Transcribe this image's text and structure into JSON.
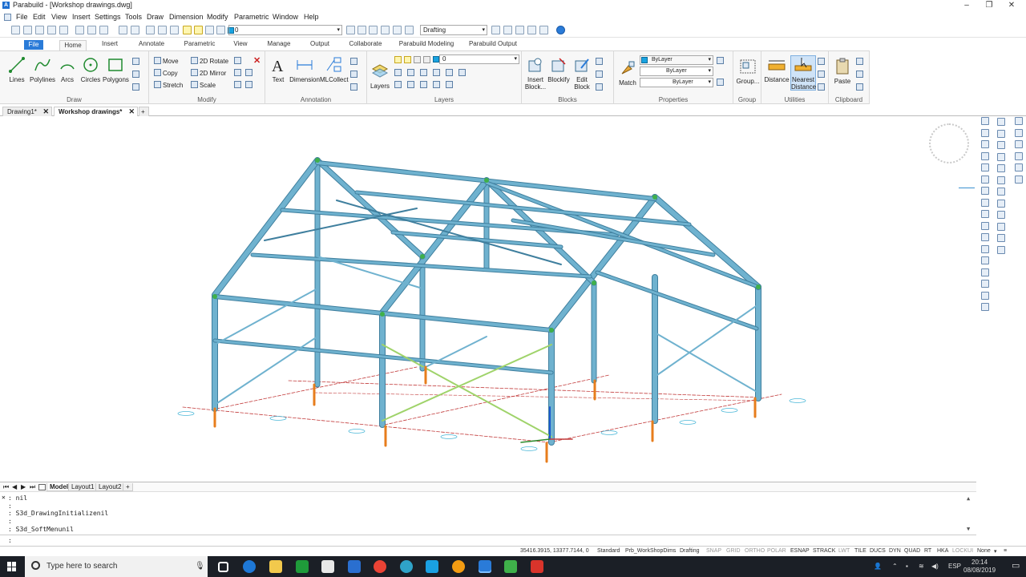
{
  "window": {
    "title": "Parabuild - [Workshop drawings.dwg]",
    "controls": [
      "–",
      "❐",
      "✕"
    ]
  },
  "menu": [
    "File",
    "Edit",
    "View",
    "Insert",
    "Settings",
    "Tools",
    "Draw",
    "Dimension",
    "Modify",
    "Parametric",
    "Window",
    "Help"
  ],
  "quickbar": {
    "layer_value": "0",
    "workspace_value": "Drafting"
  },
  "ribbon_tabs": [
    "File",
    "Home",
    "Insert",
    "Annotate",
    "Parametric",
    "View",
    "Manage",
    "Output",
    "Collaborate",
    "Parabuild Modeling",
    "Parabuild Output"
  ],
  "ribbon": {
    "draw": {
      "title": "Draw",
      "buttons": [
        "Lines",
        "Polylines",
        "Arcs",
        "Circles",
        "Polygons"
      ]
    },
    "modify": {
      "title": "Modify",
      "items": [
        "Move",
        "Copy",
        "Stretch",
        "2D Rotate",
        "2D Mirror",
        "Scale"
      ]
    },
    "annotation": {
      "title": "Annotation",
      "buttons": [
        "Text",
        "Dimension",
        "MLCollect"
      ]
    },
    "layers": {
      "title": "Layers",
      "button": "Layers",
      "layer_value": "0"
    },
    "blocks": {
      "title": "Blocks",
      "buttons": [
        "Insert\nBlock...",
        "Blockify",
        "Edit\nBlock"
      ]
    },
    "properties": {
      "title": "Properties",
      "button": "Match",
      "color": "ByLayer",
      "linetype": "ByLayer",
      "lineweight": "ByLayer"
    },
    "group": {
      "title": "Group",
      "button": "Group..."
    },
    "utilities": {
      "title": "Utilities",
      "buttons": [
        "Distance",
        "Nearest\nDistance"
      ]
    },
    "clipboard": {
      "title": "Clipboard",
      "button": "Paste"
    }
  },
  "doc_tabs": [
    {
      "label": "Drawing1*",
      "active": false
    },
    {
      "label": "Workshop drawings*",
      "active": true
    }
  ],
  "layout_tabs": [
    "Model",
    "Layout1",
    "Layout2"
  ],
  "command": {
    "lines": [
      ": nil",
      ":",
      ": S3d_DrawingInitializenil",
      ":",
      ": S3d_SoftMenunil"
    ],
    "prompt": ":"
  },
  "status": {
    "coords": "35416.3915, 13377.7144, 0",
    "standard": "Standard",
    "dimstyle": "Prb_WorkShopDims",
    "workspace": "Drafting",
    "toggles": [
      {
        "label": "SNAP",
        "on": false
      },
      {
        "label": "GRID",
        "on": false
      },
      {
        "label": "ORTHO",
        "on": false
      },
      {
        "label": "POLAR",
        "on": false
      },
      {
        "label": "ESNAP",
        "on": true
      },
      {
        "label": "STRACK",
        "on": true
      },
      {
        "label": "LWT",
        "on": false
      },
      {
        "label": "TILE",
        "on": true
      },
      {
        "label": "DUCS",
        "on": true
      },
      {
        "label": "DYN",
        "on": true
      },
      {
        "label": "QUAD",
        "on": true
      },
      {
        "label": "RT",
        "on": true
      },
      {
        "label": "HKA",
        "on": true
      },
      {
        "label": "LOCKUI",
        "on": false
      }
    ],
    "annoscale": "None"
  },
  "taskbar": {
    "search_placeholder": "Type here to search",
    "time": "20:14",
    "date": "08/08/2019",
    "lang": "ESP"
  },
  "colors": {
    "steel": "#6fb2cf",
    "steel_dark": "#3f7f9e",
    "bracing_green": "#9fd36a",
    "base": "#e77d1c",
    "grid_red": "#c23b3b",
    "accent": "#2a7bd8"
  }
}
